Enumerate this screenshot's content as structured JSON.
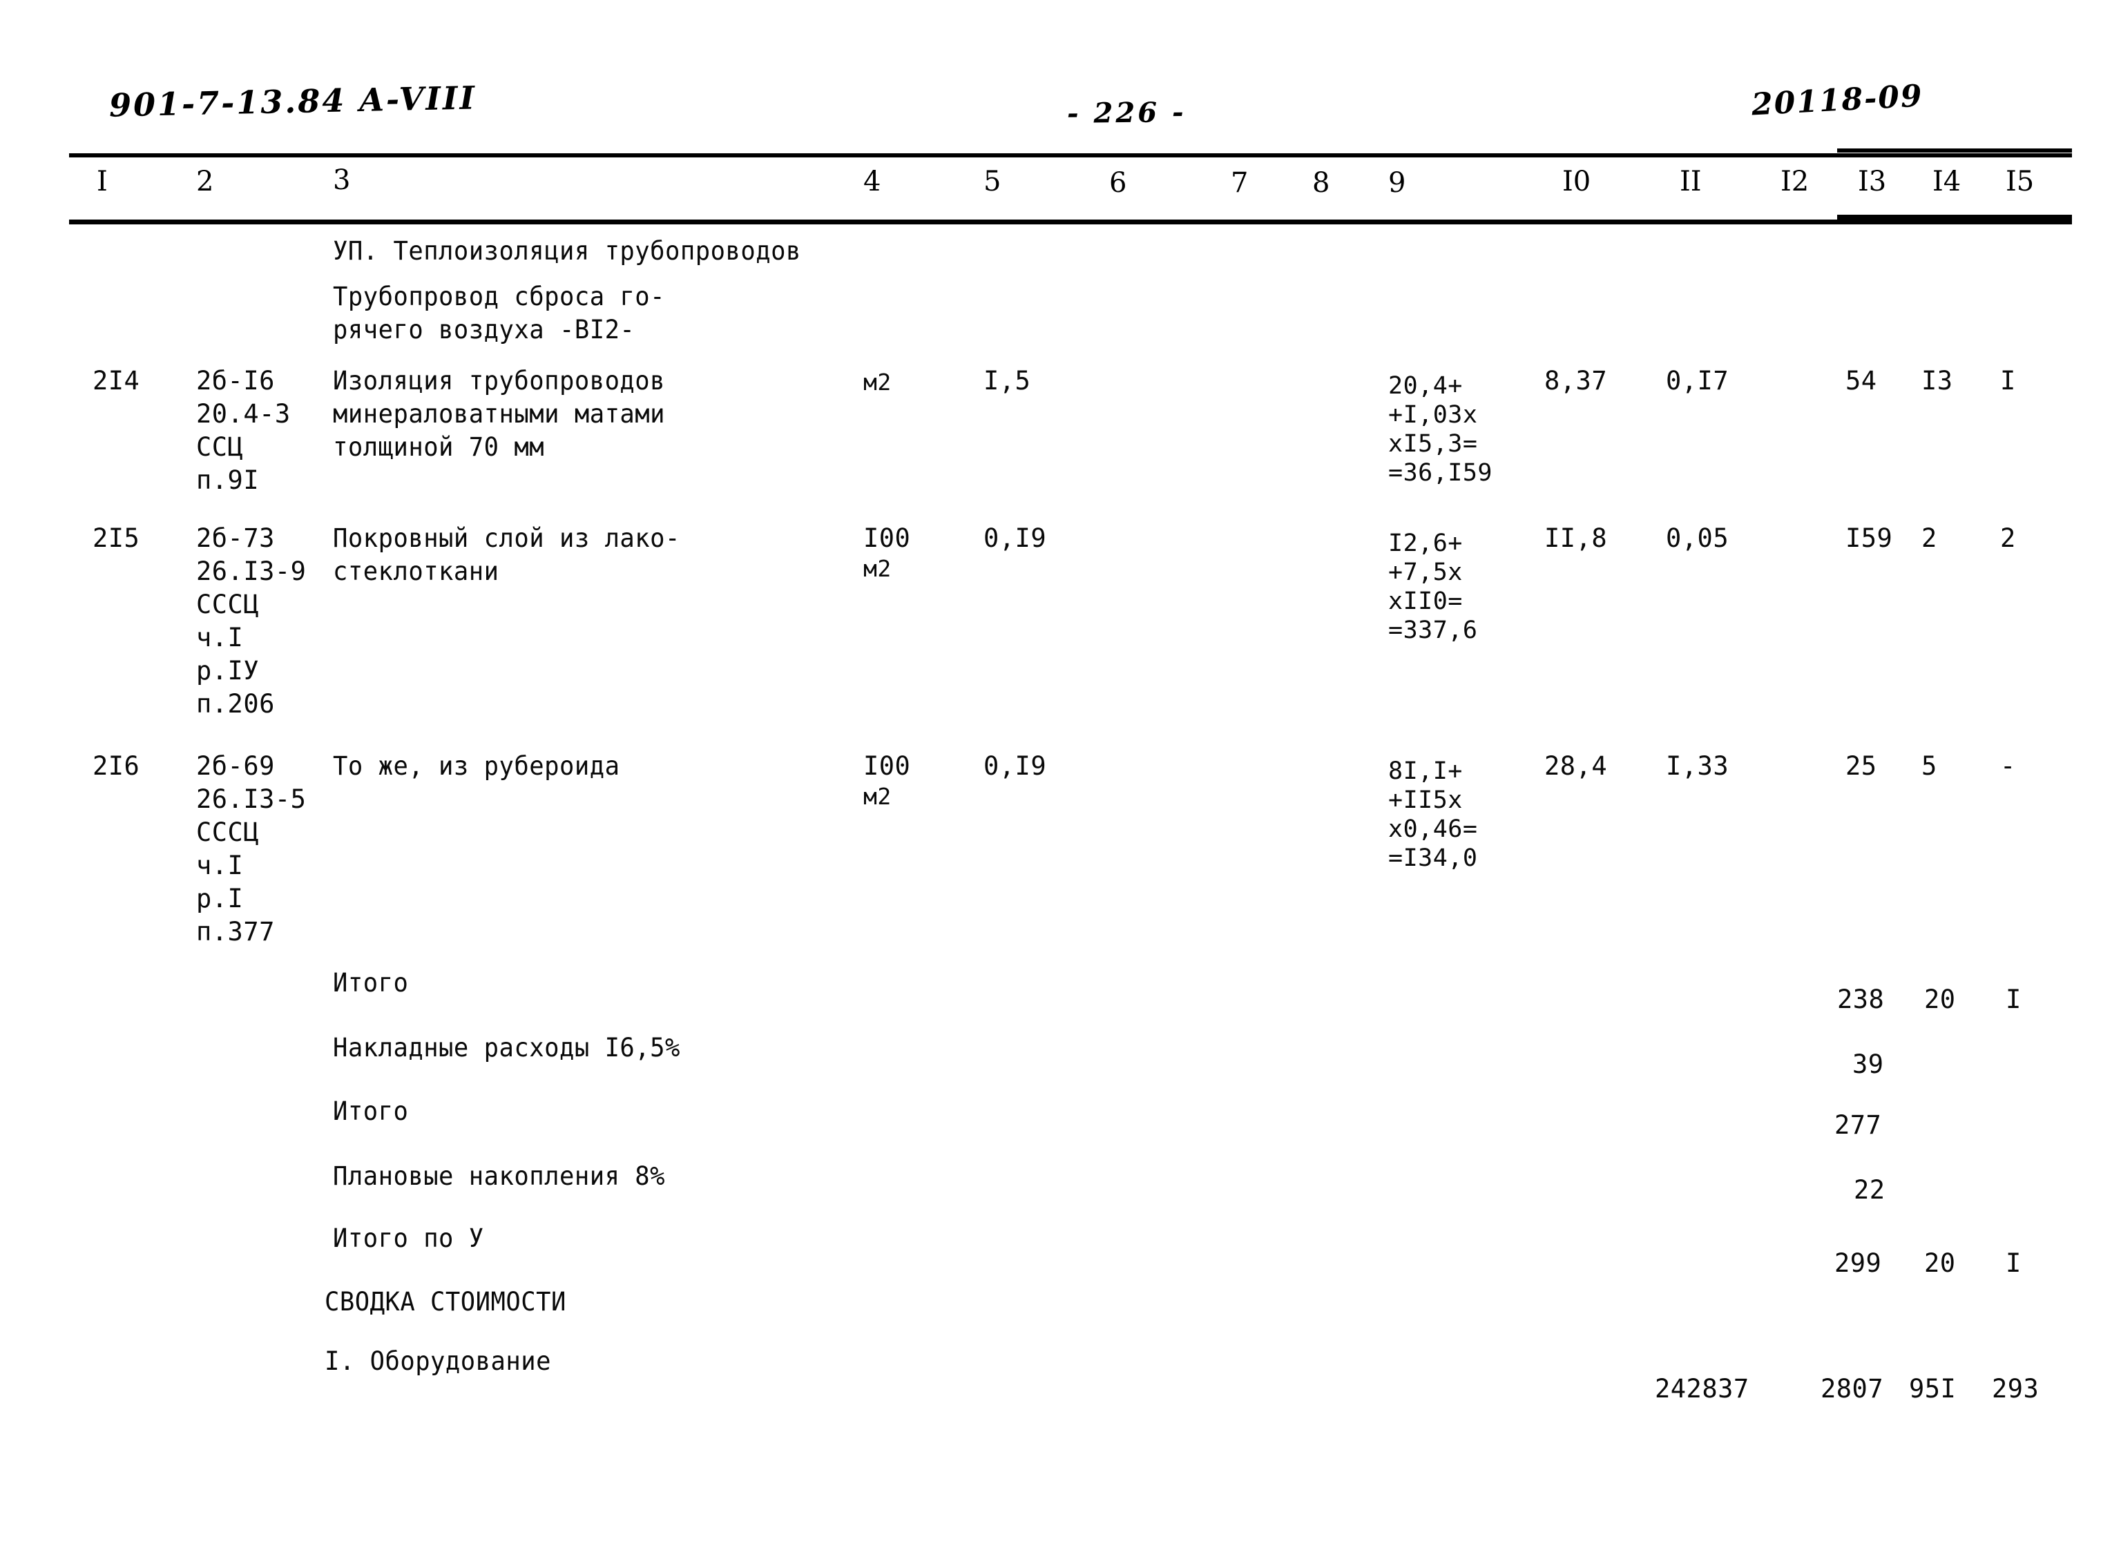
{
  "header": {
    "doc_code": "901-7-13.84  A-VIII",
    "page_number": "- 226 -",
    "sheet_code": "20118-09"
  },
  "table": {
    "column_headers": [
      "I",
      "2",
      "3",
      "4",
      "5",
      "6",
      "7",
      "8",
      "9",
      "I0",
      "II",
      "I2",
      "I3",
      "I4",
      "I5"
    ],
    "section_title": "УП. Теплоизоляция трубопроводов",
    "subsection_title_line1": "Трубопровод сброса го-",
    "subsection_title_line2": "рячего воздуха -ВI2-",
    "rows": [
      {
        "num": "2I4",
        "code_lines": [
          "2б-I6",
          "20.4-3",
          "ССЦ",
          "п.9I"
        ],
        "desc_lines": [
          "Изоляция трубопроводов",
          "минераловатными матами",
          "толщиной 70 мм"
        ],
        "unit_lines": [
          "м2"
        ],
        "qty": "I,5",
        "formula_lines": [
          "20,4+",
          "+I,03x",
          "xI5,3=",
          "=36,I59"
        ],
        "c10": "8,37",
        "c11": "0,I7",
        "c12": "",
        "c13": "54",
        "c14": "I3",
        "c15": "I"
      },
      {
        "num": "2I5",
        "code_lines": [
          "2б-73",
          "26.I3-9",
          "СССЦ",
          "ч.I",
          "р.IУ",
          "п.206"
        ],
        "desc_lines": [
          "Покровный слой из лако-",
          "стеклоткани"
        ],
        "unit_lines": [
          "I00",
          "м2"
        ],
        "qty": "0,I9",
        "formula_lines": [
          "I2,6+",
          "+7,5x",
          "xII0=",
          "=337,6"
        ],
        "c10": "II,8",
        "c11": "0,05",
        "c12": "",
        "c13": "I59",
        "c14": "2",
        "c15": "2"
      },
      {
        "num": "2I6",
        "code_lines": [
          "2б-69",
          "26.I3-5",
          "СССЦ",
          "ч.I",
          "р.I",
          "п.377"
        ],
        "desc_lines": [
          "То же, из рубероида"
        ],
        "unit_lines": [
          "I00",
          "м2"
        ],
        "qty": "0,I9",
        "formula_lines": [
          "8I,I+",
          "+II5x",
          "x0,46=",
          "=I34,0"
        ],
        "c10": "28,4",
        "c11": "I,33",
        "c12": "",
        "c13": "25",
        "c14": "5",
        "c15": "-"
      }
    ],
    "summary_rows": [
      {
        "label": "Итого",
        "c13": "238",
        "c14": "20",
        "c15": "I"
      },
      {
        "label": "Накладные расходы I6,5%",
        "c13": "39",
        "c14": "",
        "c15": ""
      },
      {
        "label": "Итого",
        "c13": "277",
        "c14": "",
        "c15": ""
      },
      {
        "label": "Плановые накопления 8%",
        "c13": "22",
        "c14": "",
        "c15": ""
      },
      {
        "label": "Итого по У",
        "c13": "299",
        "c14": "20",
        "c15": "I"
      },
      {
        "label": "СВОДКА СТОИМОСТИ",
        "c13": "",
        "c14": "",
        "c15": ""
      },
      {
        "label": "I. Оборудование",
        "c12": "242837",
        "c13": "2807",
        "c14": "95I",
        "c15": "293"
      }
    ]
  }
}
